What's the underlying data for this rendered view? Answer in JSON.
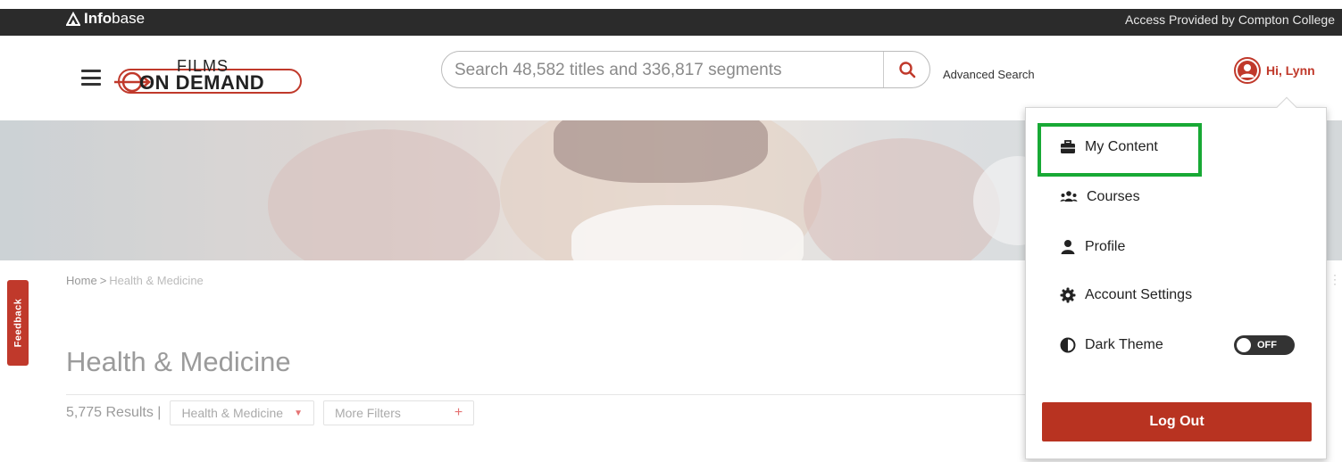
{
  "topbar": {
    "brand_bold": "Info",
    "brand_rest": "base",
    "access_text": "Access Provided by Compton College"
  },
  "header": {
    "logo_top": "FILMS",
    "logo_bottom": "ON DEMAND",
    "search_placeholder": "Search 48,582 titles and 336,817 segments",
    "advanced_search": "Advanced Search",
    "user_greeting": "Hi, Lynn"
  },
  "breadcrumb": {
    "home": "Home",
    "separator": ">",
    "current": "Health & Medicine"
  },
  "feedback_label": "Feedback",
  "main": {
    "title": "Health & Medicine",
    "results": "5,775 Results |",
    "filters": [
      {
        "label": "Health & Medicine"
      },
      {
        "label": "More Filters"
      }
    ]
  },
  "user_menu": {
    "items": [
      {
        "label": "My Content",
        "icon": "briefcase-icon"
      },
      {
        "label": "Courses",
        "icon": "users-icon"
      },
      {
        "label": "Profile",
        "icon": "user-icon"
      },
      {
        "label": "Account Settings",
        "icon": "gear-icon"
      },
      {
        "label": "Dark Theme",
        "icon": "contrast-icon"
      }
    ],
    "dark_theme_state": "OFF",
    "logout_label": "Log Out"
  },
  "colors": {
    "brand_red": "#c0392b",
    "highlight_green": "#18a935",
    "topbar": "#2b2b2b"
  }
}
